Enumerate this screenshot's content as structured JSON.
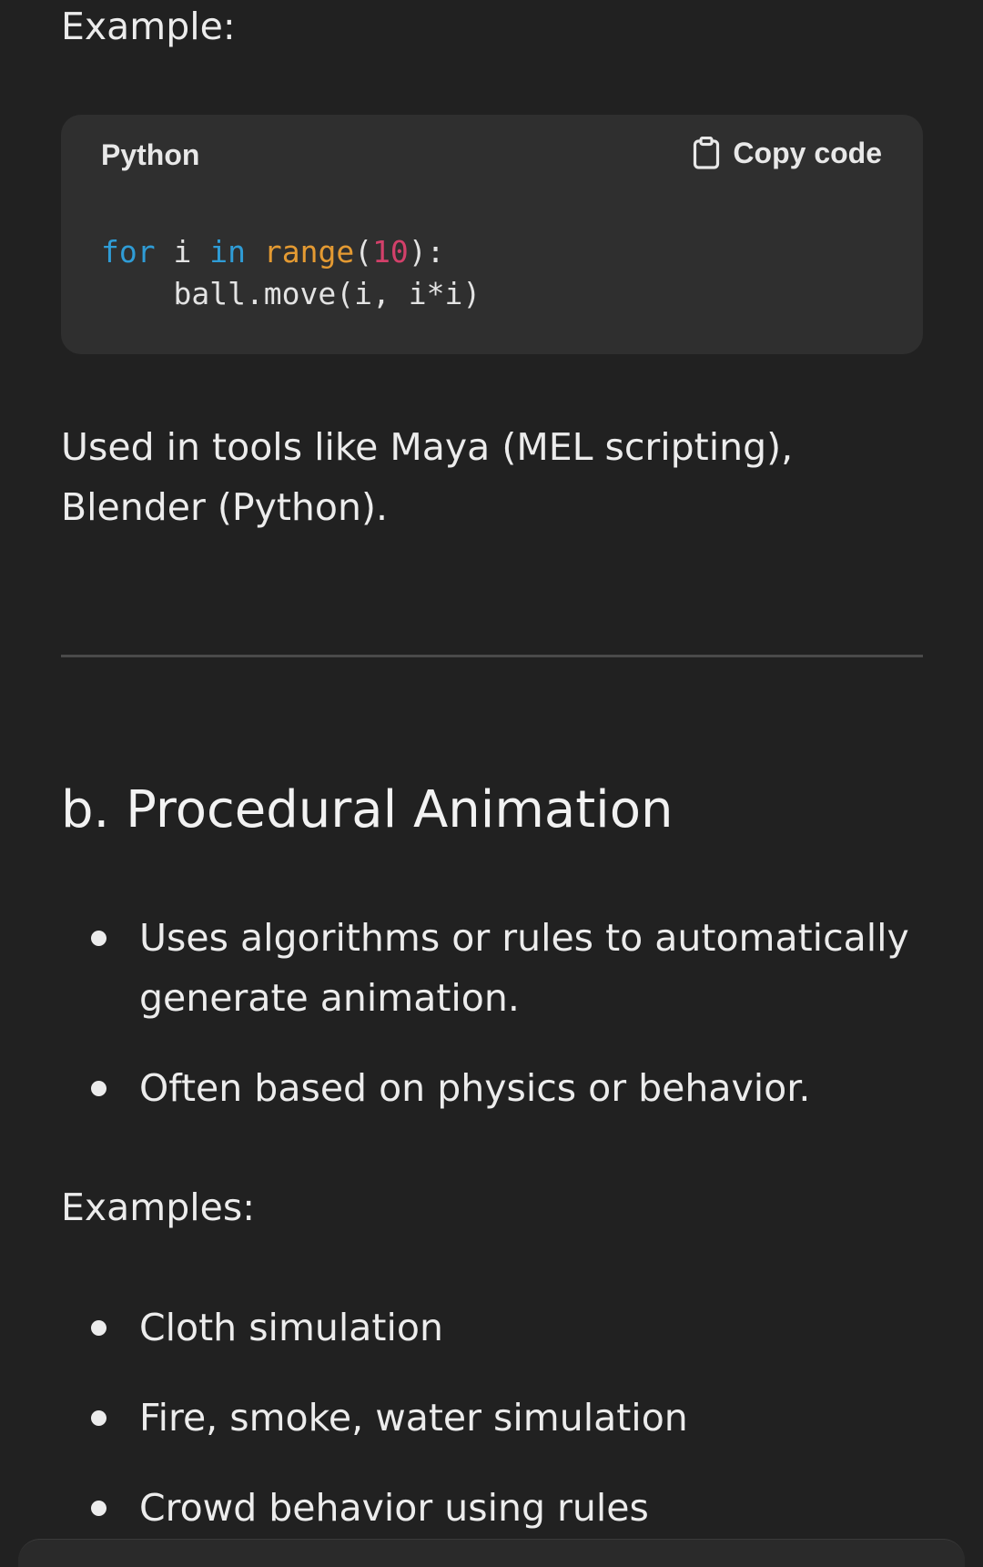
{
  "example_label": "Example:",
  "code_block": {
    "language": "Python",
    "copy_label": "Copy code",
    "copy_icon": "clipboard-icon",
    "line1": {
      "kw_for": "for",
      "var_i": " i ",
      "kw_in": "in",
      "space": " ",
      "fn_range": "range",
      "paren_open": "(",
      "num": "10",
      "paren_close": "):"
    },
    "line2": "    ball.move(i, i*i)"
  },
  "paragraph": "Used in tools like Maya (MEL scripting), Blender (Python).",
  "section_heading": "b. Procedural Animation",
  "bullets_main": [
    "Uses algorithms or rules to automatically generate animation.",
    "Often based on physics or behavior."
  ],
  "examples_label": "Examples:",
  "bullets_examples": [
    "Cloth simulation",
    "Fire, smoke, water simulation",
    "Crowd behavior using rules"
  ],
  "colors": {
    "background": "#212121",
    "code_background": "#2f2f2f",
    "keyword": "#2f9cd6",
    "function": "#e49a32",
    "number": "#d3406a"
  }
}
